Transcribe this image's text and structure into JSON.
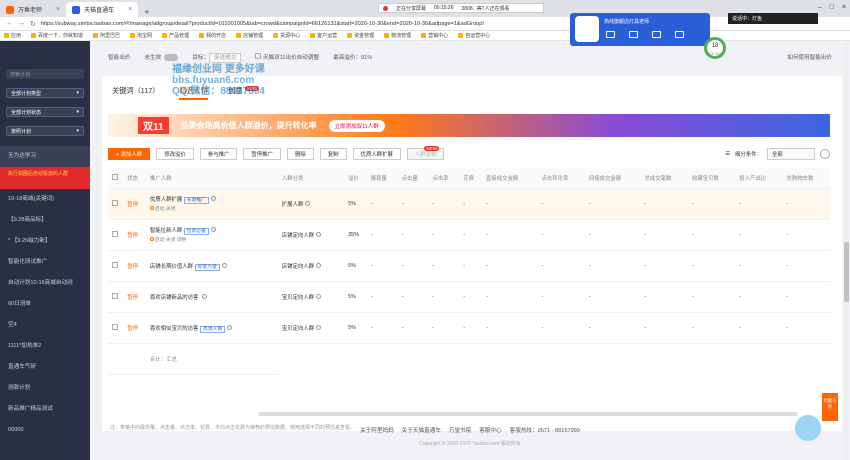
{
  "browser": {
    "tabs": [
      {
        "label": "万鱼老师",
        "active": false
      },
      {
        "label": "天猫直通车",
        "active": true
      }
    ],
    "url": "https://subway.simba.taobao.com/#!/manage/adgroup/detail?productId=101001005&tab=crowd&campaignId=66126131&start=2020-10-30&end=2020-10-30&adpage=1&adGroupI",
    "bookmarks": [
      "应用",
      "百度一下，你就知道",
      "阿里巴巴",
      "淘宝网",
      "产品管理",
      "我的开店",
      "店铺管理",
      "货源中心",
      "客户运营",
      "资金管理",
      "物流管理",
      "营销中心",
      "自运营中心"
    ],
    "share": {
      "label": "正在分享屏幕",
      "time": "00:15:26",
      "viewers": "3808...等7人正在观看"
    }
  },
  "sidebar": {
    "search_placeholder": "搜索计划",
    "selects": [
      "全部计划类型",
      "全部计划状态",
      "按照计划"
    ],
    "items": [
      {
        "label": "无为达学习",
        "style": "normal"
      },
      {
        "label": "执行如图后自动投放的人群",
        "style": "red"
      },
      {
        "label": "10-18商城(关键词)",
        "style": "normal"
      },
      {
        "label": "【9.28商品标】",
        "style": "normal"
      },
      {
        "label": "* 【9.26磁力新】",
        "style": "normal"
      },
      {
        "label": "智能化测试推广",
        "style": "normal"
      },
      {
        "label": "自动计划10-16商城自动测",
        "style": "normal"
      },
      {
        "label": "60日测单",
        "style": "normal"
      },
      {
        "label": "空4",
        "style": "normal"
      },
      {
        "label": "1111*加热单2",
        "style": "normal"
      },
      {
        "label": "直通车气研",
        "style": "normal"
      },
      {
        "label": "测款计划",
        "style": "normal"
      },
      {
        "label": "新品推广精品测试",
        "style": "normal"
      },
      {
        "label": "00000",
        "style": "normal"
      }
    ]
  },
  "topline": {
    "smart_bid": "智能出价",
    "not_effective": "未生效",
    "goal_label": "目标：",
    "goal_value": "促进成交",
    "double11_label": "天猫双11出价自动调整",
    "max_premium": "最高溢价：91%",
    "help": "如何使用智能出价"
  },
  "panel": {
    "tabs": [
      {
        "label": "关键词（117）",
        "active": false
      },
      {
        "label": "精选人群",
        "active": true
      },
      {
        "label": "创意",
        "active": false,
        "new": "NEW"
      }
    ],
    "banner": {
      "tag": "双11",
      "text": "品类会场高价值人群溢价，提升转化率",
      "button": "立即添加双11人群"
    },
    "toolbar": {
      "buttons": [
        {
          "label": "+ 添加人群",
          "type": "primary"
        },
        {
          "label": "修改溢价",
          "type": "normal"
        },
        {
          "label": "参与推广",
          "type": "normal"
        },
        {
          "label": "暂停推广",
          "type": "normal"
        },
        {
          "label": "删除",
          "type": "normal"
        },
        {
          "label": "复制",
          "type": "normal"
        },
        {
          "label": "优质人群扩展",
          "type": "normal"
        },
        {
          "label": "人群复制",
          "type": "disabled"
        }
      ],
      "new_badge": "NEW",
      "filter_label": "细分条件：",
      "filter_value": "全部"
    },
    "table": {
      "headers": [
        "状态",
        "推广人群",
        "人群分类",
        "溢价",
        "展现量",
        "点击量",
        "点击率",
        "花费",
        "直接成交金额",
        "点击转化率",
        "间接成交金额",
        "总成交笔数",
        "收藏宝贝数",
        "投入产出比",
        "总购物车数"
      ],
      "rows": [
        {
          "status": "暂停",
          "name": "优质人群扩展",
          "tag": "长期推广",
          "sub": "启动  关闭",
          "category": "扩展人群",
          "premium": "5%",
          "selected": true
        },
        {
          "status": "暂停",
          "name": "智能拉新人群",
          "tag": "拉新必备",
          "sub": "启动  关闭  调整",
          "category": "店铺定向人群",
          "premium": "35%",
          "selected": false
        },
        {
          "status": "暂停",
          "name": "店铺长期价值人群",
          "tag": "好客力量",
          "sub": "",
          "category": "店铺定向人群",
          "premium": "5%",
          "selected": false
        },
        {
          "status": "暂停",
          "name": "喜欢店铺新品的访客",
          "tag": "",
          "sub": "",
          "category": "宝贝定向人群",
          "premium": "5%",
          "selected": false
        },
        {
          "status": "暂停",
          "name": "喜欢相似宝贝的访客",
          "tag": "高潜人群",
          "sub": "",
          "category": "宝贝定向人群",
          "premium": "5%",
          "selected": false
        }
      ],
      "total_label": "合计：汇总",
      "dash": "-"
    },
    "footnote": "注：表格中的展现量、点击量、点击率、花费、平均点击花费为推荐的预估数据，使用选择不同的预估来查看。"
  },
  "footer": {
    "links": [
      "关于阿里妈妈",
      "关于天猫直通车",
      "万堂书院",
      "客服中心",
      "客服热线：0571 - 88157999"
    ],
    "copyright": "Copyright © 2003-2020 Taobao.com 版权所有"
  },
  "widgets": {
    "shop_name": "热线旗舰店灯具老师",
    "gauge_value": "18",
    "gauge_sub": "110.3K/s",
    "speaking": "说话中：灯鱼",
    "float_btn": "功能引导",
    "watermark_lines": [
      "福缘创业网 更多好课",
      "bbs.fuyuan6.com",
      "QQ/微信：88037604"
    ]
  },
  "colors": {
    "accent": "#ff6600",
    "sidebar": "#2a2f45",
    "brand_blue": "#2b5fd9"
  }
}
